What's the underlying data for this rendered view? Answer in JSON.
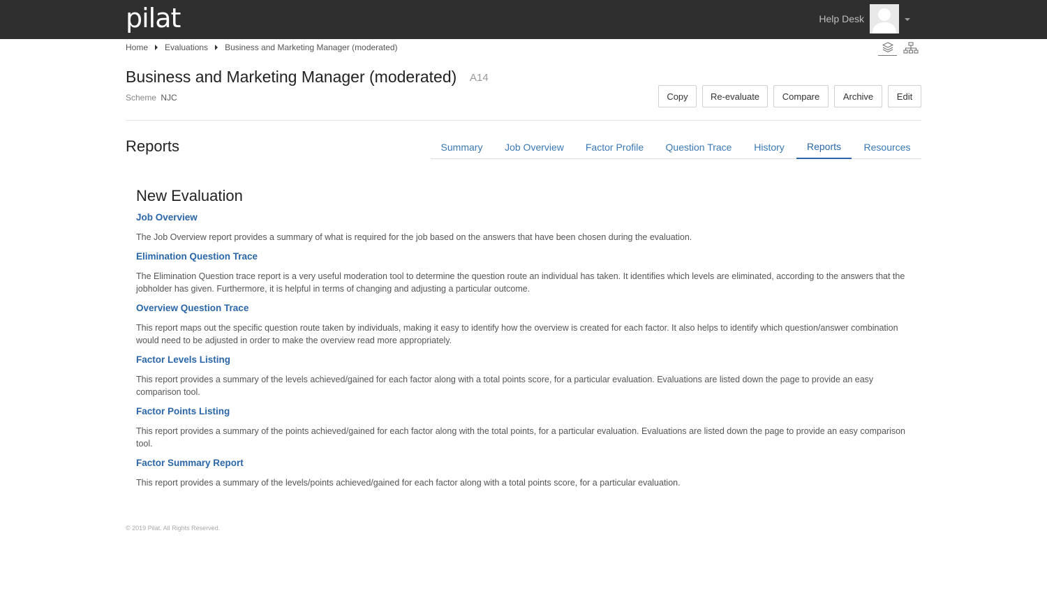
{
  "header": {
    "logo": "pilat",
    "user_name": "Help Desk"
  },
  "breadcrumb": {
    "home": "Home",
    "evaluations": "Evaluations",
    "current": "Business and Marketing Manager (moderated)"
  },
  "page": {
    "title": "Business and Marketing Manager (moderated)",
    "code": "A14",
    "scheme_label": "Scheme",
    "scheme_value": "NJC"
  },
  "actions": {
    "copy": "Copy",
    "reevaluate": "Re-evaluate",
    "compare": "Compare",
    "archive": "Archive",
    "edit": "Edit"
  },
  "section": {
    "title": "Reports"
  },
  "tabs": [
    {
      "label": "Summary",
      "active": false
    },
    {
      "label": "Job Overview",
      "active": false
    },
    {
      "label": "Factor Profile",
      "active": false
    },
    {
      "label": "Question Trace",
      "active": false
    },
    {
      "label": "History",
      "active": false
    },
    {
      "label": "Reports",
      "active": true
    },
    {
      "label": "Resources",
      "active": false
    }
  ],
  "reports": {
    "heading": "New Evaluation",
    "items": [
      {
        "title": "Job Overview",
        "description": "The Job Overview report provides a summary of what is required for the job based on the answers that have been chosen during the evaluation."
      },
      {
        "title": "Elimination Question Trace",
        "description": "The Elimination Question trace report is a very useful moderation tool to determine the question route an individual has taken. It identifies which levels are eliminated, according to the answers that the jobholder has given. Furthermore, it is helpful in terms of changing and adjusting a particular outcome."
      },
      {
        "title": "Overview Question Trace",
        "description": "This report maps out the specific question route taken by individuals, making it easy to identify how the overview is created for each factor. It also helps to identify which question/answer combination would need to be adjusted in order to make the overview read more appropriately."
      },
      {
        "title": "Factor Levels Listing",
        "description": "This report provides a summary of the levels achieved/gained for each factor along with a total points score, for a particular evaluation. Evaluations are listed down the page to provide an easy comparison tool."
      },
      {
        "title": "Factor Points Listing",
        "description": "This report provides a summary of the points achieved/gained for each factor along with the total points, for a particular evaluation. Evaluations are listed down the page to provide an easy comparison tool."
      },
      {
        "title": "Factor Summary Report",
        "description": "This report provides a summary of the levels/points achieved/gained for each factor along with a total points score, for a particular evaluation."
      }
    ]
  },
  "footer": {
    "copyright": "© 2019 Pilat. All Rights Reserved."
  },
  "colors": {
    "topbar": "#2f2f2f",
    "link": "#2a66a8",
    "text": "#555555"
  }
}
